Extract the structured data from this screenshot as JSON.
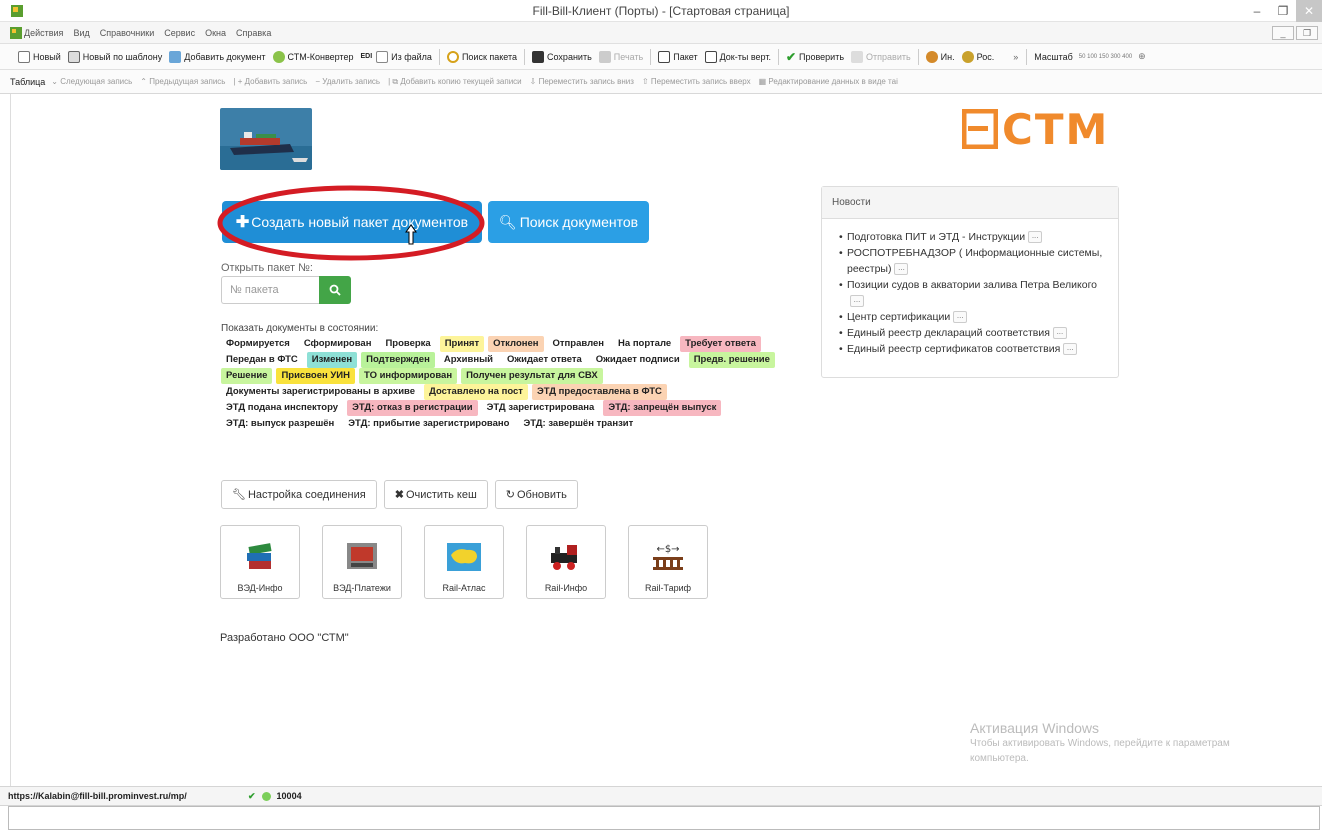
{
  "window": {
    "title": "Fill-Bill-Клиент (Порты) - [Стартовая страница]"
  },
  "menubar": {
    "items": [
      "Действия",
      "Вид",
      "Справочники",
      "Сервис",
      "Окна",
      "Справка"
    ]
  },
  "toolbar1": {
    "items": [
      "Новый",
      "Новый по шаблону",
      "Добавить документ",
      "СТМ-Конвертер",
      "Из файла",
      "Поиск пакета",
      "Сохранить",
      "Печать",
      "Пакет",
      "Док-ты верт.",
      "Проверить",
      "Отправить",
      "Ин.",
      "Рос."
    ],
    "edi": "EDI",
    "zoom_label": "Масштаб",
    "zoom_values": "50  100  150  300  400"
  },
  "toolbar2": {
    "table": "Таблица",
    "items": [
      "Следующая запись",
      "Предыдущая запись",
      "Добавить запись",
      "Удалить запись",
      "Добавить копию текущей записи",
      "Переместить запись вниз",
      "Переместить запись вверх",
      "Редактирование данных в виде таі"
    ]
  },
  "logo": {
    "text": "СТМ"
  },
  "main": {
    "create_button": "Создать новый пакет документов",
    "search_button": "Поиск документов",
    "open_label": "Открыть пакет №:",
    "pkg_placeholder": "№ пакета",
    "states_label": "Показать документы в состоянии:",
    "states": [
      {
        "t": "Формируется",
        "c": ""
      },
      {
        "t": "Сформирован",
        "c": ""
      },
      {
        "t": "Проверка",
        "c": ""
      },
      {
        "t": "Принят",
        "c": "#fdf49a"
      },
      {
        "t": "Отклонен",
        "c": "#fbd3b3"
      },
      {
        "t": "Отправлен",
        "c": ""
      },
      {
        "t": "На портале",
        "c": ""
      },
      {
        "t": "Требует ответа",
        "c": "#f7b7c0"
      },
      {
        "t": "Передан в ФТС",
        "c": ""
      },
      {
        "t": "Изменен",
        "c": "#8ee0d6"
      },
      {
        "t": "Подтвержден",
        "c": "#b9f29a"
      },
      {
        "t": "Архивный",
        "c": ""
      },
      {
        "t": "Ожидает ответа",
        "c": ""
      },
      {
        "t": "Ожидает подписи",
        "c": ""
      },
      {
        "t": "Предв. решение",
        "c": "#c8f59e"
      },
      {
        "t": "Решение",
        "c": "#c8f59e"
      },
      {
        "t": "Присвоен УИН",
        "c": "#f9e23c"
      },
      {
        "t": "ТО информирован",
        "c": "#c8f59e"
      },
      {
        "t": "Получен результат для СВХ",
        "c": "#c8f59e"
      },
      {
        "t": "Документы зарегистрированы в архиве",
        "c": ""
      },
      {
        "t": "Доставлено на пост",
        "c": "#fdf49a"
      },
      {
        "t": "ЭТД предоставлена в ФТС",
        "c": "#fbd3b3"
      },
      {
        "t": "ЭТД подана инспектору",
        "c": ""
      },
      {
        "t": "ЭТД: отказ в регистрации",
        "c": "#f7b7c0"
      },
      {
        "t": "ЭТД зарегистрирована",
        "c": ""
      },
      {
        "t": "ЭТД: запрещён выпуск",
        "c": "#f7b7c0"
      },
      {
        "t": "ЭТД: выпуск разрешён",
        "c": ""
      },
      {
        "t": "ЭТД: прибытие зарегистрировано",
        "c": ""
      },
      {
        "t": "ЭТД: завершён транзит",
        "c": ""
      }
    ],
    "tools": [
      "Настройка соединения",
      "Очистить кеш",
      "Обновить"
    ],
    "apps": [
      "ВЭД-Инфо",
      "ВЭД-Платежи",
      "Rail-Атлас",
      "Rail-Инфо",
      "Rail-Тариф"
    ],
    "developed": "Разработано ООО \"СТМ\""
  },
  "news": {
    "title": "Новости",
    "items": [
      "Подготовка ПИТ и ЭТД - Инструкции",
      "РОСПОТРЕБНАДЗОР ( Информационные системы, реестры)",
      "Позиции судов в акватории залива Петра Великого",
      "Центр сертификации",
      "Единый реестр деклараций соответствия",
      "Единый реестр сертификатов соответствия"
    ],
    "more": "..."
  },
  "watermark": {
    "line1": "Активация Windows",
    "line2": "Чтобы активировать Windows, перейдите к параметрам компьютера."
  },
  "statusbar": {
    "url": "https://Kalabin@fill-bill.prominvest.ru/mp/",
    "code": "10004"
  }
}
